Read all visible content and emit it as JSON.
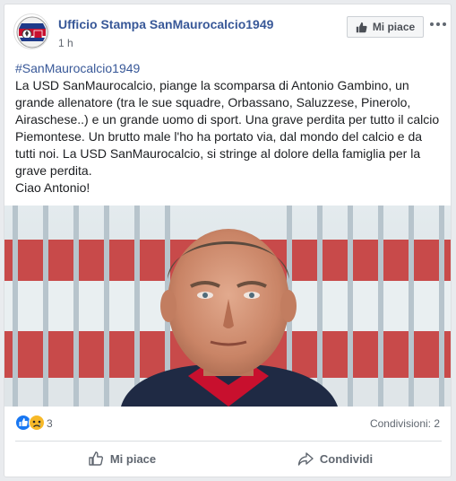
{
  "post": {
    "page_name": "Ufficio Stampa SanMaurocalcio1949",
    "timestamp": "1 h",
    "like_page_label": "Mi piace",
    "hashtag": "#SanMaurocalcio1949",
    "body_lines": [
      "La USD SanMaurocalcio, piange la scomparsa di Antonio Gambino, un",
      "grande allenatore (tra le sue squadre, Orbassano, Saluzzese, Pinerolo,",
      "Airaschese..) e un grande uomo di sport. Una grave perdita per tutto il calcio",
      "Piemontese. Un brutto male l'ho ha portato via, dal mondo del calcio e da",
      "tutti noi. La USD SanMaurocalcio, si stringe al dolore della famiglia per la",
      "grave perdita.",
      "Ciao Antonio!"
    ]
  },
  "stats": {
    "reaction_count": "3",
    "reactions": [
      "like-reaction-icon",
      "sad-reaction-icon"
    ],
    "shares_label": "Condivisioni: 2"
  },
  "actions": {
    "like_label": "Mi piace",
    "share_label": "Condividi"
  },
  "colors": {
    "link": "#385898",
    "like_blue": "#1877f2",
    "sad_yellow": "#f7b928"
  }
}
